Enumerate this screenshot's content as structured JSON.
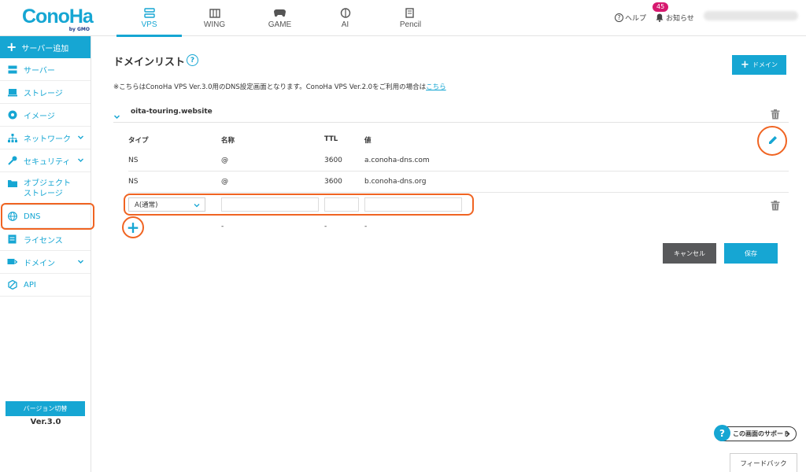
{
  "header": {
    "logo": {
      "word": "ConoHa",
      "sub": "by GMO"
    },
    "nav": [
      {
        "label": "VPS",
        "icon": "server-icon",
        "active": true
      },
      {
        "label": "WING",
        "icon": "building-icon",
        "active": false
      },
      {
        "label": "GAME",
        "icon": "gamepad-icon",
        "active": false
      },
      {
        "label": "AI",
        "icon": "brain-icon",
        "active": false
      },
      {
        "label": "Pencil",
        "icon": "pencil-doc-icon",
        "active": false
      }
    ],
    "help_label": "ヘルプ",
    "notice_label": "お知らせ",
    "notice_count": "45"
  },
  "sidebar": {
    "add_server": "サーバー追加",
    "items": [
      {
        "label": "サーバー",
        "icon": "server-icon"
      },
      {
        "label": "ストレージ",
        "icon": "storage-icon"
      },
      {
        "label": "イメージ",
        "icon": "image-icon"
      },
      {
        "label": "ネットワーク",
        "icon": "network-icon",
        "expandable": true
      },
      {
        "label": "セキュリティ",
        "icon": "key-icon",
        "expandable": true
      },
      {
        "label": "オブジェクトストレージ",
        "line1": "オブジェクト",
        "line2": "ストレージ",
        "icon": "folder-icon"
      },
      {
        "label": "DNS",
        "icon": "globe-icon",
        "active": true
      },
      {
        "label": "ライセンス",
        "icon": "license-icon"
      },
      {
        "label": "ドメイン",
        "icon": "domain-icon",
        "expandable": true
      },
      {
        "label": "API",
        "icon": "api-icon"
      }
    ],
    "version_button": "バージョン切替",
    "version_value": "Ver.3.0"
  },
  "main": {
    "title": "ドメインリスト",
    "add_domain_label": "ドメイン",
    "note_text": "※こちらはConoHa VPS Ver.3.0用のDNS設定画面となります。ConoHa VPS Ver.2.0をご利用の場合は",
    "note_link": "こちら",
    "domain_name": "oita-touring.website",
    "columns": [
      "タイプ",
      "名称",
      "TTL",
      "値"
    ],
    "records": [
      {
        "type": "NS",
        "name": "@",
        "ttl": "3600",
        "value": "a.conoha-dns.com"
      },
      {
        "type": "NS",
        "name": "@",
        "ttl": "3600",
        "value": "b.conoha-dns.org"
      }
    ],
    "new_record": {
      "type_selected": "A(通常)",
      "name": "",
      "ttl": "",
      "value": ""
    },
    "placeholder_row": {
      "name": "-",
      "ttl": "-",
      "value": "-"
    },
    "cancel_label": "キャンセル",
    "save_label": "保存"
  },
  "footer": {
    "support_label": "この画面のサポート",
    "feedback_label": "フィードバック"
  },
  "colors": {
    "accent": "#16a6d3",
    "highlight": "#f06422",
    "cancel": "#58595b",
    "badge": "#d6196f"
  }
}
